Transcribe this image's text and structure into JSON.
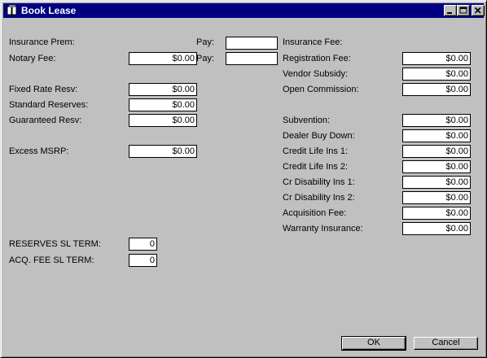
{
  "window": {
    "title": "Book Lease"
  },
  "left": {
    "insurance_prem_label": "Insurance Prem:",
    "notary_fee_label": "Notary Fee:",
    "notary_fee_value": "$0.00",
    "pay_label_1": "Pay:",
    "pay_label_2": "Pay:",
    "pay_value_1": "",
    "pay_value_2": "",
    "fixed_rate_resv_label": "Fixed Rate Resv:",
    "fixed_rate_resv_value": "$0.00",
    "standard_reserves_label": "Standard Reserves:",
    "standard_reserves_value": "$0.00",
    "guaranteed_resv_label": "Guaranteed Resv:",
    "guaranteed_resv_value": "$0.00",
    "excess_msrp_label": "Excess MSRP:",
    "excess_msrp_value": "$0.00",
    "reserves_sl_term_label": "RESERVES SL TERM:",
    "reserves_sl_term_value": "0",
    "acq_fee_sl_term_label": "ACQ. FEE SL TERM:",
    "acq_fee_sl_term_value": "0"
  },
  "right": {
    "insurance_fee_label": "Insurance Fee:",
    "registration_fee_label": "Registration Fee:",
    "registration_fee_value": "$0.00",
    "vendor_subsidy_label": "Vendor Subsidy:",
    "vendor_subsidy_value": "$0.00",
    "open_commission_label": "Open Commission:",
    "open_commission_value": "$0.00",
    "subvention_label": "Subvention:",
    "subvention_value": "$0.00",
    "dealer_buy_down_label": "Dealer Buy Down:",
    "dealer_buy_down_value": "$0.00",
    "credit_life_ins_1_label": "Credit Life Ins 1:",
    "credit_life_ins_1_value": "$0.00",
    "credit_life_ins_2_label": "Credit Life Ins 2:",
    "credit_life_ins_2_value": "$0.00",
    "cr_disability_ins_1_label": "Cr Disability Ins 1:",
    "cr_disability_ins_1_value": "$0.00",
    "cr_disability_ins_2_label": "Cr Disability Ins 2:",
    "cr_disability_ins_2_value": "$0.00",
    "acquisition_fee_label": "Acquisition Fee:",
    "acquisition_fee_value": "$0.00",
    "warranty_insurance_label": "Warranty Insurance:",
    "warranty_insurance_value": "$0.00"
  },
  "buttons": {
    "ok_label": "OK",
    "cancel_label": "Cancel"
  },
  "icons": {
    "app_icon": "book-icon",
    "minimize": "minimize-icon",
    "maximize": "maximize-icon",
    "close": "close-icon"
  },
  "colors": {
    "title_bar": "#000080",
    "background": "#c0c0c0",
    "field": "#ffffff"
  }
}
